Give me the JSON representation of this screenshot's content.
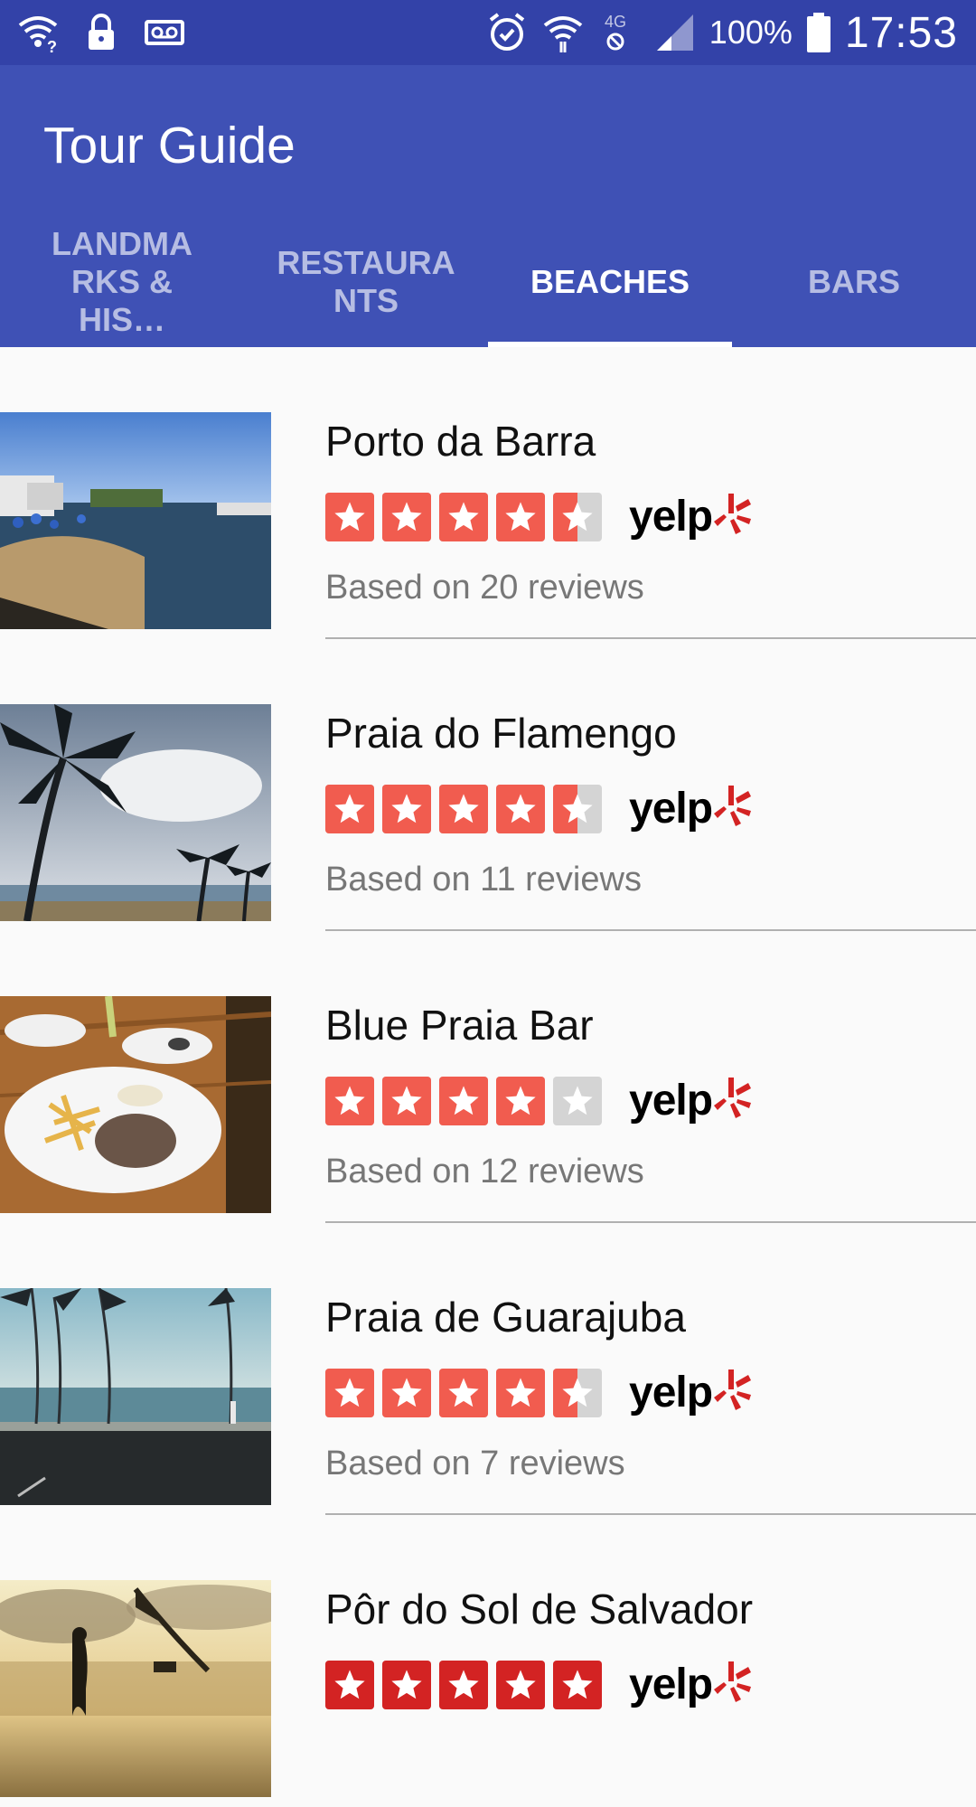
{
  "status_bar": {
    "battery_percent": "100%",
    "time": "17:53",
    "network_label": "4G",
    "left_icons": [
      "wifi-question-icon",
      "lock-icon",
      "voicemail-icon"
    ],
    "right_icons": [
      "alarm-icon",
      "wifi-icon",
      "data-off-icon",
      "signal-icon",
      "battery-icon"
    ]
  },
  "app_bar": {
    "title": "Tour Guide",
    "background": "#3f51b5",
    "status_background": "#3342a8"
  },
  "tabs": [
    {
      "label": "LANDMA\nRKS & HIS…",
      "active": false
    },
    {
      "label": "RESTAURA\nNTS",
      "active": false
    },
    {
      "label": "BEACHES",
      "active": true
    },
    {
      "label": "BARS",
      "active": false
    }
  ],
  "colors": {
    "star_fill": "#f15c4f",
    "star_fill_5": "#d32323",
    "star_empty": "#d4d4d4",
    "yelp_burst": "#d32323"
  },
  "items": [
    {
      "name": "Porto da Barra",
      "rating": 4.5,
      "reviews": "Based on 20 reviews",
      "photo": "beach-photo"
    },
    {
      "name": "Praia do Flamengo",
      "rating": 4.5,
      "reviews": "Based on 11 reviews",
      "photo": "palm-trees-photo"
    },
    {
      "name": "Blue Praia Bar",
      "rating": 4,
      "reviews": "Based on 12 reviews",
      "photo": "food-plate-photo"
    },
    {
      "name": "Praia de Guarajuba",
      "rating": 4.5,
      "reviews": "Based on 7 reviews",
      "photo": "seaside-road-photo"
    },
    {
      "name": "Pôr do Sol de Salvador",
      "rating": 5,
      "reviews": "",
      "photo": "sunset-photo"
    }
  ],
  "yelp": {
    "word": "yelp"
  }
}
